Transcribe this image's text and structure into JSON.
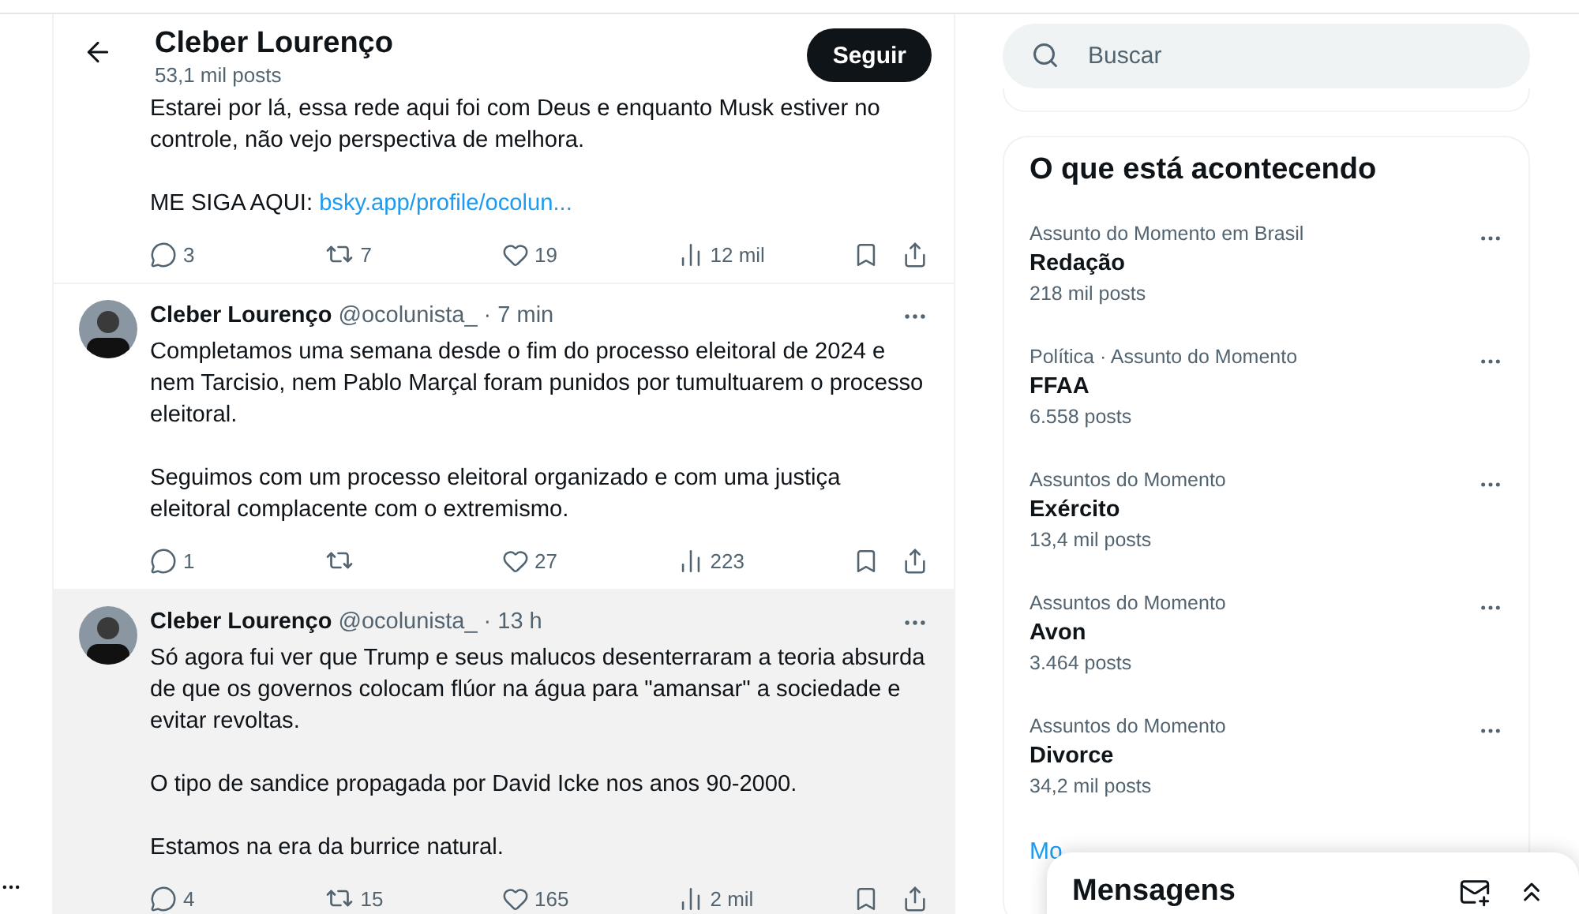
{
  "profile_header": {
    "name": "Cleber Lourenço",
    "post_count": "53,1 mil posts",
    "follow_button": "Seguir"
  },
  "posts": [
    {
      "kind": "continued",
      "paragraphs": [
        "Estarei por lá, essa rede aqui foi com Deus e enquanto Musk estiver no controle, não vejo perspectiva de melhora."
      ],
      "link_prefix": "ME SIGA AQUI:",
      "link": "bsky.app/profile/ocolun...",
      "replies": "3",
      "reposts": "7",
      "likes": "19",
      "views": "12 mil",
      "hovered": false
    },
    {
      "kind": "full",
      "author": "Cleber Lourenço",
      "handle": "@ocolunista_",
      "time": "· 7 min",
      "paragraphs": [
        "Completamos uma semana desde o fim do processo eleitoral de 2024 e nem Tarcisio, nem Pablo Marçal foram punidos por tumultuarem o processo eleitoral.",
        "Seguimos com um processo eleitoral organizado e com uma justiça eleitoral complacente com o extremismo."
      ],
      "replies": "1",
      "likes": "27",
      "views": "223",
      "hovered": false
    },
    {
      "kind": "full",
      "author": "Cleber Lourenço",
      "handle": "@ocolunista_",
      "time": "· 13 h",
      "paragraphs": [
        "Só agora fui ver que Trump e seus malucos desenterraram a teoria absurda de que os governos colocam flúor na água para \"amansar\" a sociedade e evitar revoltas.",
        "O tipo de sandice propagada por David Icke nos anos 90-2000.",
        "Estamos na era da burrice natural."
      ],
      "replies": "4",
      "reposts": "15",
      "likes": "165",
      "views": "2 mil",
      "hovered": true
    }
  ],
  "search": {
    "placeholder": "Buscar"
  },
  "trends": {
    "title": "O que está acontecendo",
    "items": [
      {
        "context": "Assunto do Momento em Brasil",
        "topic": "Redação",
        "count": "218 mil posts"
      },
      {
        "context": "Política · Assunto do Momento",
        "topic": "FFAA",
        "count": "6.558 posts"
      },
      {
        "context": "Assuntos do Momento",
        "topic": "Exército",
        "count": "13,4 mil posts"
      },
      {
        "context": "Assuntos do Momento",
        "topic": "Avon",
        "count": "3.464 posts"
      },
      {
        "context": "Assuntos do Momento",
        "topic": "Divorce",
        "count": "34,2 mil posts"
      }
    ],
    "show_more": "Mo"
  },
  "messages": {
    "title": "Mensagens"
  }
}
